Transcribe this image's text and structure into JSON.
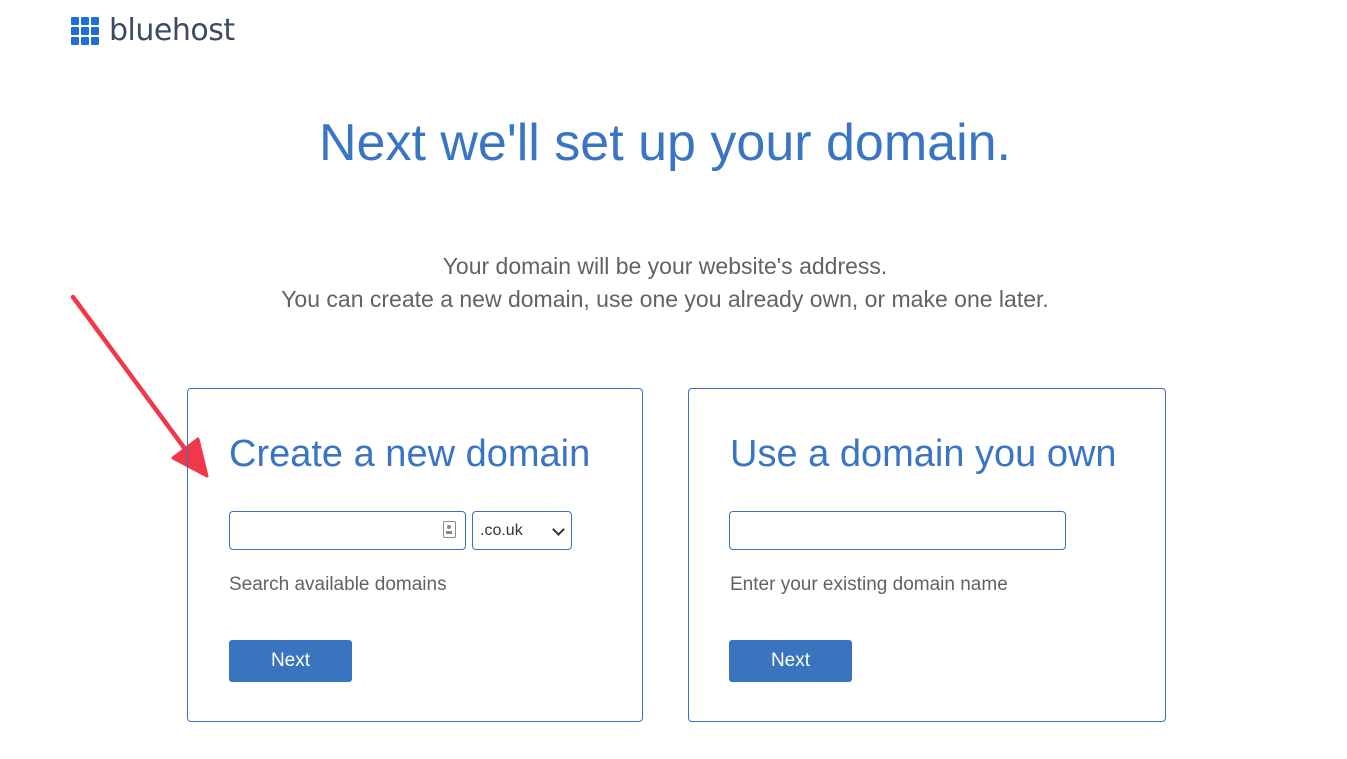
{
  "header": {
    "logo_text": "bluehost"
  },
  "main": {
    "title": "Next we'll set up your domain.",
    "subtitle_line1": "Your domain will be your website's address.",
    "subtitle_line2": "You can create a new domain, use one you already own, or make one later."
  },
  "new_domain_card": {
    "title": "Create a new domain",
    "input_value": "",
    "tld_selected": ".co.uk",
    "helper": "Search available domains",
    "button_label": "Next"
  },
  "own_domain_card": {
    "title": "Use a domain you own",
    "input_value": "",
    "helper": "Enter your existing domain name",
    "button_label": "Next"
  },
  "colors": {
    "brand_blue": "#3a75c4",
    "button_blue": "#3a73be",
    "arrow_red": "#f0384a",
    "logo_blue": "#1f6ddb"
  },
  "icons": {
    "logo": "grid-logo-icon",
    "input_autofill": "contact-card-icon",
    "select_chevron": "chevron-down-icon",
    "annotation": "red-arrow-icon"
  }
}
